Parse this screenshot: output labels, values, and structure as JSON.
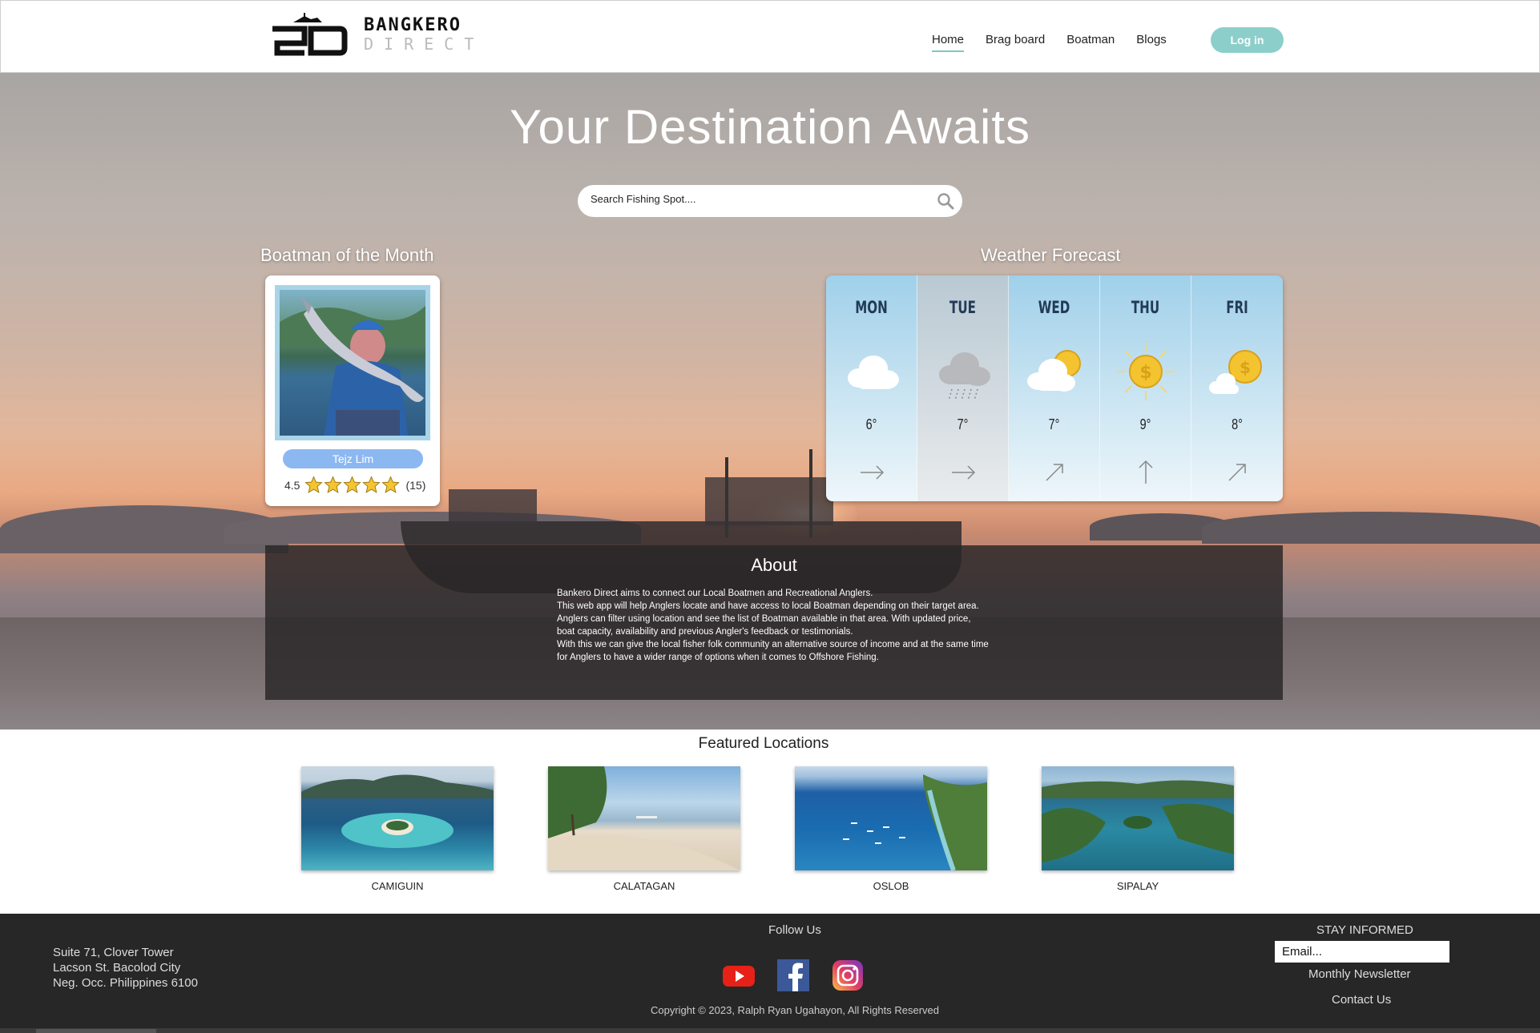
{
  "header": {
    "logo_line1": "BANGKERO",
    "logo_line2": "DIRECT",
    "nav": [
      {
        "label": "Home",
        "active": true
      },
      {
        "label": "Brag board",
        "active": false
      },
      {
        "label": "Boatman",
        "active": false
      },
      {
        "label": "Blogs",
        "active": false
      }
    ],
    "login_label": "Log in",
    "login_color": "#8ccfca"
  },
  "hero": {
    "title": "Your Destination Awaits",
    "search_placeholder": "Search Fishing Spot....",
    "search_icon": "search-icon"
  },
  "boatman": {
    "section_title": "Boatman of the Month",
    "name": "Tejz Lim",
    "rating": "4.5",
    "stars": 5,
    "reviews": "(15)"
  },
  "weather": {
    "section_title": "Weather Forecast",
    "days": [
      {
        "day": "MON",
        "icon": "cloud-icon",
        "temp": "6°",
        "wind": "arrow-right-icon"
      },
      {
        "day": "TUE",
        "icon": "rain-cloud-icon",
        "temp": "7°",
        "wind": "arrow-right-icon"
      },
      {
        "day": "WED",
        "icon": "partly-cloudy-icon",
        "temp": "7°",
        "wind": "arrow-up-right-icon"
      },
      {
        "day": "THU",
        "icon": "sun-icon",
        "temp": "9°",
        "wind": "arrow-up-icon"
      },
      {
        "day": "FRI",
        "icon": "partly-sunny-icon",
        "temp": "8°",
        "wind": "arrow-up-right-icon"
      }
    ]
  },
  "about": {
    "title": "About",
    "text": "Bankero Direct aims to connect our Local Boatmen and Recreational Anglers.\nThis web app will help Anglers locate and have access to local Boatman depending on their target area.\nAnglers can filter using location and see the list of Boatman available in that area. With updated price,\n boat capacity, availability and previous Angler's feedback or testimonials.\nWith this we can give the local fisher folk community an alternative source of income and at the same time\nfor Anglers to have a wider range of options when it comes to Offshore Fishing."
  },
  "featured": {
    "title": "Featured Locations",
    "locations": [
      "CAMIGUIN",
      "CALATAGAN",
      "OSLOB",
      "SIPALAY"
    ]
  },
  "footer": {
    "address": [
      "Suite 71, Clover Tower",
      "Lacson St. Bacolod City",
      "Neg. Occ. Philippines 6100"
    ],
    "follow_label": "Follow Us",
    "socials": [
      "youtube-icon",
      "facebook-icon",
      "instagram-icon"
    ],
    "copyright": "Copyright © 2023, Ralph Ryan Ugahayon, All Rights Reserved",
    "stay_label": "STAY INFORMED",
    "email_placeholder": "Email...",
    "newsletter_label": "Monthly Newsletter",
    "contact_label": "Contact Us"
  }
}
